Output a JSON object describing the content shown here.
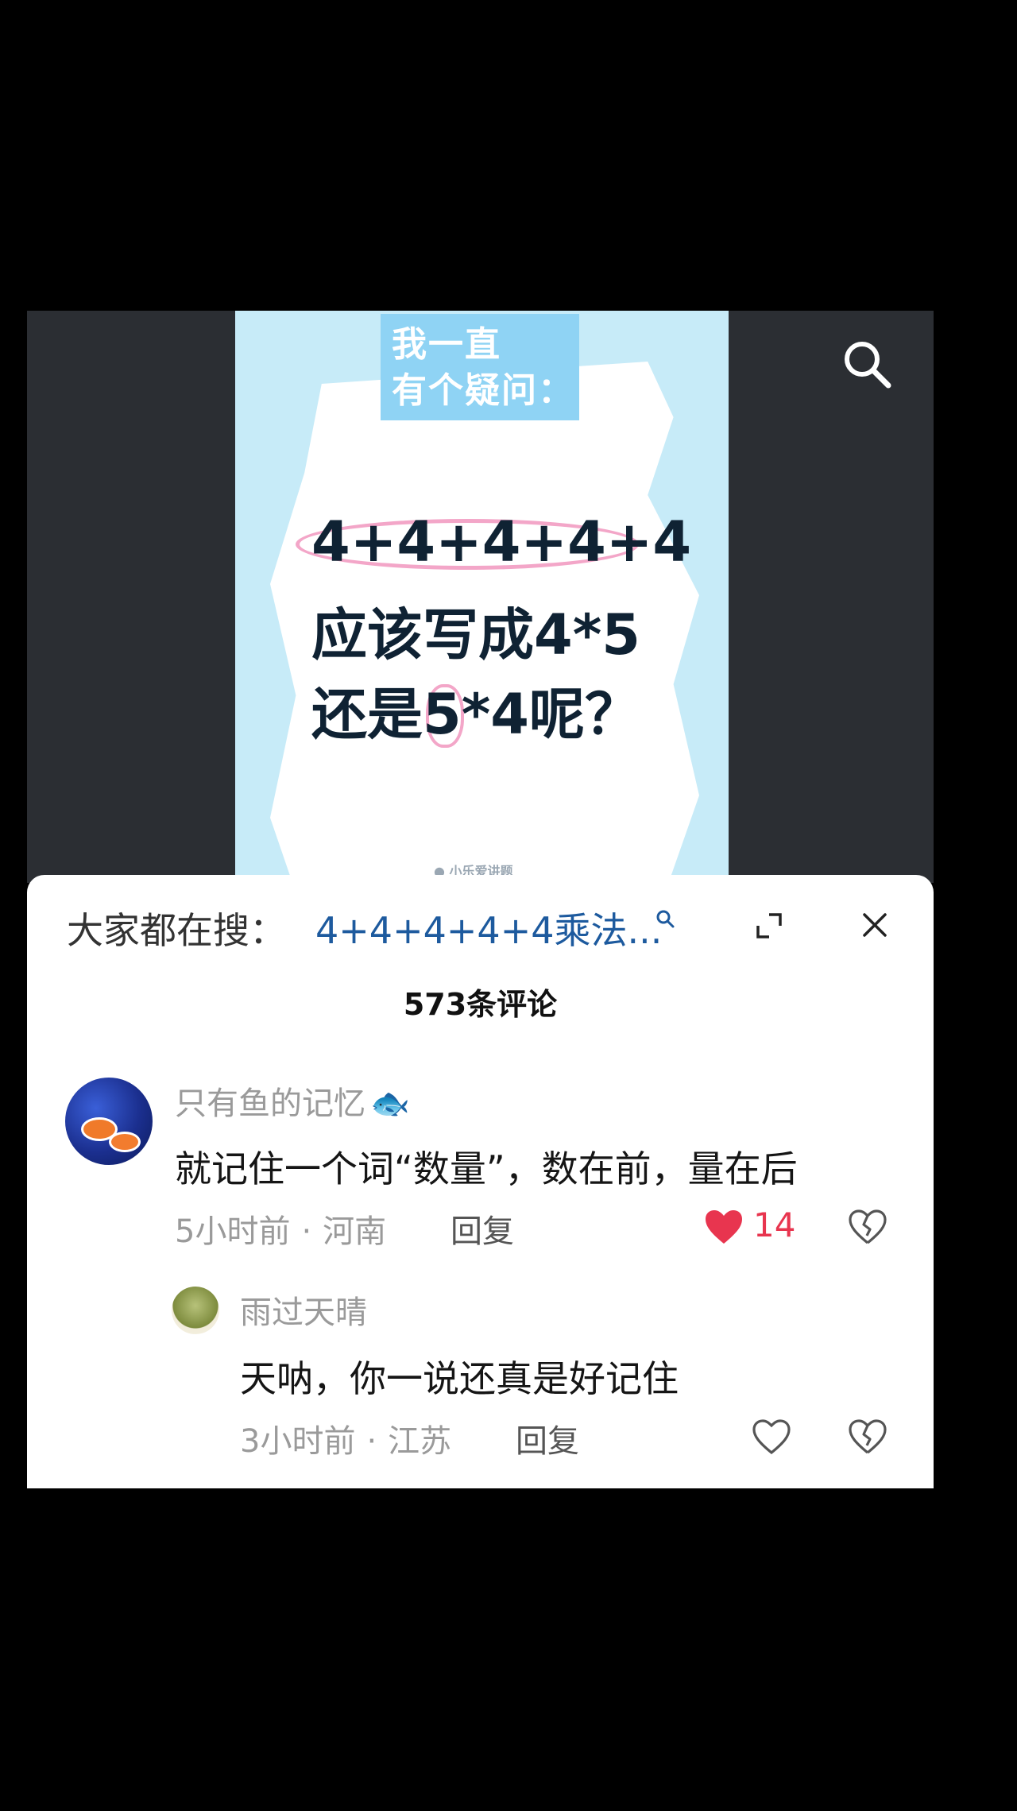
{
  "media": {
    "poster_tag_line1": "我一直",
    "poster_tag_line2": "有个疑问：",
    "poster_line1": "4+4+4+4+4",
    "poster_line2": "应该写成4*5",
    "poster_line3": "还是5*4呢？",
    "poster_footer": "● 小乐爱讲题",
    "search_icon": "search-icon"
  },
  "sheet": {
    "hot_search_label": "大家都在搜：",
    "hot_search_query": "4+4+4+4+4乘法...",
    "comment_count": "573条评论"
  },
  "comments": [
    {
      "user": "只有鱼的记忆",
      "text": "就记住一个词“数量”，数在前，量在后",
      "time": "5小时前",
      "location": "河南",
      "reply": "回复",
      "likes": "14",
      "liked": true
    },
    {
      "user": "雨过天晴",
      "text": "天呐，你一说还真是好记住",
      "time": "3小时前",
      "location": "江苏",
      "reply": "回复",
      "likes": "",
      "liked": false
    }
  ],
  "colors": {
    "accent_like": "#e8354f",
    "query_link": "#1d5a9e",
    "poster_bg": "#c7ebf8"
  }
}
